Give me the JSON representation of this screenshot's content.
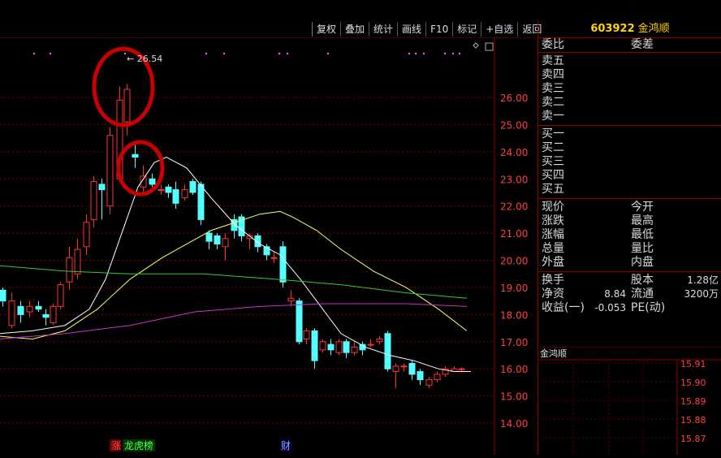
{
  "toolbar": {
    "buttons": [
      "复权",
      "叠加",
      "统计",
      "画线",
      "F10",
      "标记",
      "+自选",
      "返回"
    ]
  },
  "stock": {
    "code": "603922",
    "name": "金鸿顺"
  },
  "chart": {
    "price_axis": [
      "26.00",
      "25.00",
      "24.00",
      "23.00",
      "22.00",
      "21.00",
      "20.00",
      "19.00",
      "18.00",
      "17.00",
      "16.00",
      "15.00",
      "14.00"
    ],
    "high_label": "← 26.54",
    "markers": {
      "zhang": "涨",
      "longhu": "龙虎榜",
      "cai": "财"
    },
    "colors": {
      "up": "#ff3232",
      "down": "#54ffff",
      "ma5": "#ffffff",
      "ma10": "#ffff66",
      "ma20": "#33cc33",
      "ma60": "#cc33cc",
      "grid": "#7a0000",
      "circle": "#c80000"
    }
  },
  "quote": {
    "weibi_label": "委比",
    "weicha_label": "委差",
    "sells": [
      "卖五",
      "卖四",
      "卖三",
      "卖二",
      "卖一"
    ],
    "buys": [
      "买一",
      "买二",
      "买三",
      "买四",
      "买五"
    ],
    "stats": [
      [
        "现价",
        "今开"
      ],
      [
        "涨跌",
        "最高"
      ],
      [
        "涨幅",
        "最低"
      ],
      [
        "总量",
        "量比"
      ],
      [
        "外盘",
        "内盘"
      ]
    ],
    "extra": [
      {
        "l": "换手",
        "v1": "",
        "m": "股本",
        "v2": "1.28亿"
      },
      {
        "l": "净资",
        "v1": "8.84",
        "m": "流通",
        "v2": "3200万"
      },
      {
        "l": "收益(一)",
        "v1": "-0.053",
        "m": "PE(动)",
        "v2": ""
      }
    ]
  },
  "mini_chart": {
    "title": "金鸿顺",
    "axis": [
      "15.91",
      "15.90",
      "15.89",
      "15.88",
      "15.87"
    ]
  }
}
